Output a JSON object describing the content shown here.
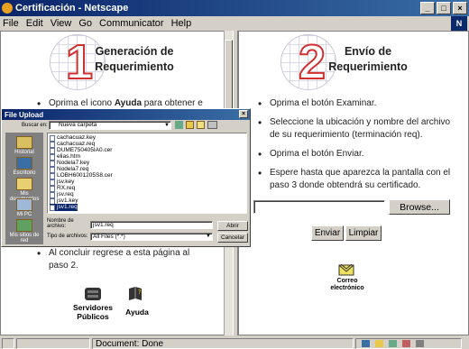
{
  "window": {
    "title": "Certificación - Netscape",
    "minimize": "_",
    "maximize": "□",
    "close": "×"
  },
  "menu": [
    "File",
    "Edit",
    "View",
    "Go",
    "Communicator",
    "Help"
  ],
  "left": {
    "number": "1",
    "heading_line1": "Generación de",
    "heading_line2": "Requerimiento",
    "bullet1_a": "Oprima el icono ",
    "bullet1_bold": "Ayuda",
    "bullet1_b": " para obtener e",
    "bullet_last_line1": "Al concluir regrese a esta página al",
    "bullet_last_line2": "paso 2.",
    "icon1_line1": "Servidores",
    "icon1_line2": "Públicos",
    "icon2": "Ayuda"
  },
  "right": {
    "number": "2",
    "heading_line1": "Envío de",
    "heading_line2": "Requerimiento",
    "bullets": [
      [
        "Oprima el botón Examinar."
      ],
      [
        "Seleccione la ubicación y nombre del archivo",
        "de su requerimiento (terminación req)."
      ],
      [
        "Oprima el botón Enviar."
      ],
      [
        "Espere hasta que aparezca la pantalla con el",
        "paso 3 donde obtendrá su certificado."
      ]
    ],
    "browse": "Browse...",
    "enviar": "Enviar",
    "limpiar": "Limpiar",
    "correo_line1": "Correo",
    "correo_line2": "electrónico"
  },
  "dialog": {
    "title": "File Upload",
    "buscar_en": "Buscar en:",
    "folder": "Nueva carpeta",
    "places": [
      "Historial",
      "Escritorio",
      "Mis documentos",
      "Mi PC",
      "Mis sitios de red"
    ],
    "files": [
      "cachacuaz.key",
      "cachacuaz.req",
      "DUME750405IA0.cer",
      "elias.htm",
      "Nodela7.key",
      "Nodela7.req",
      "LOBH6001205S8.cer",
      "jsv.key",
      "RX.req",
      "jsv.req",
      "jsv1.key",
      "jsv1.req"
    ],
    "selected_index": 11,
    "filename_label1": "Nombre de",
    "filename_label2": "archivo:",
    "filename_value": "jsv1.req",
    "filetype_label": "Tipo de archivos:",
    "filetype_value": "All Files (*.*)",
    "open": "Abrir",
    "cancel": "Cancelar"
  },
  "status": {
    "text": "Document: Done"
  }
}
